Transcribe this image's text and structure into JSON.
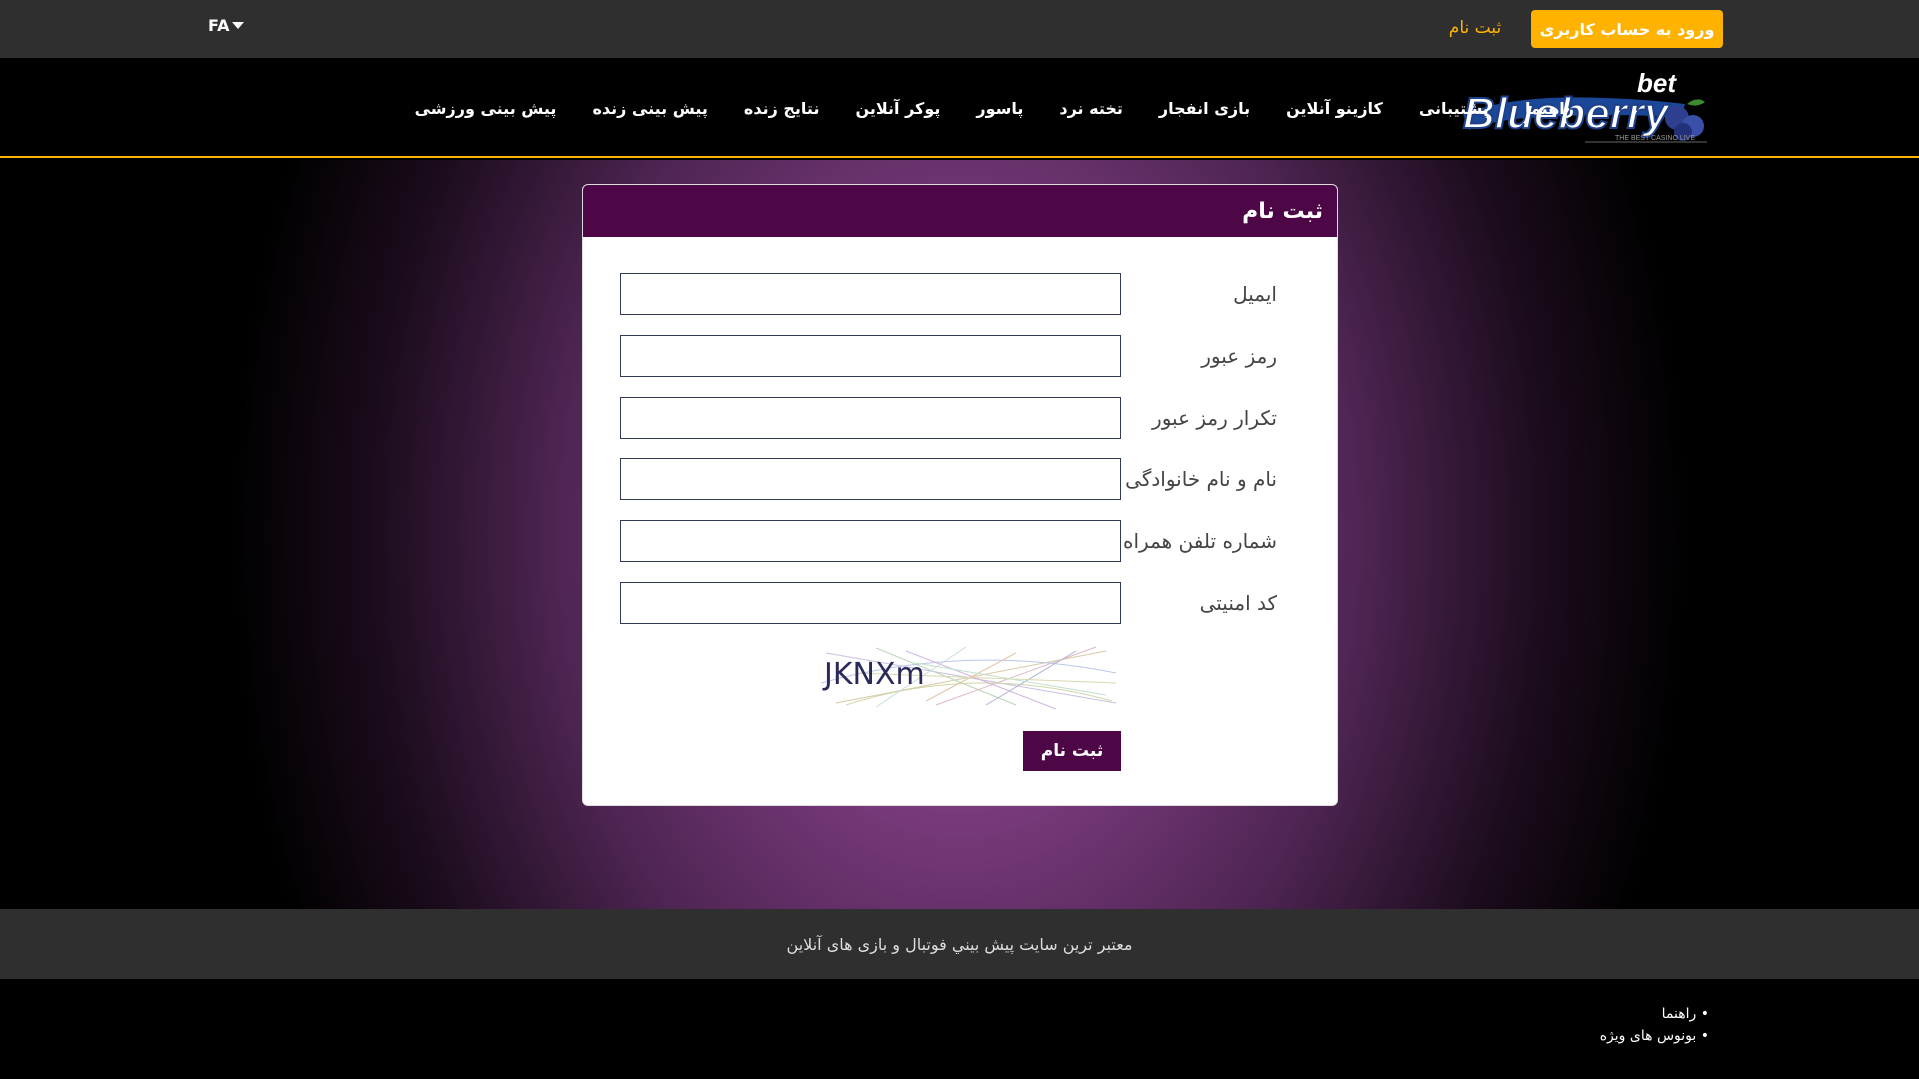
{
  "topbar": {
    "language": "FA",
    "login_label": "ورود به حساب کاربری",
    "register_label": "ثبت نام"
  },
  "logo": {
    "top": "bet",
    "name": "Blueberry",
    "tagline": "THE BEST CASINO LIVE"
  },
  "nav": {
    "items": [
      {
        "label": "پیش بینی ورزشی"
      },
      {
        "label": "پیش بینی زنده"
      },
      {
        "label": "نتایج زنده"
      },
      {
        "label": "پوکر آنلاین"
      },
      {
        "label": "پاسور"
      },
      {
        "label": "تخته نرد"
      },
      {
        "label": "بازی انفجار"
      },
      {
        "label": "کازینو آنلاین"
      },
      {
        "label": "پشتیبانی"
      },
      {
        "label": "راهنما"
      }
    ]
  },
  "form": {
    "title": "ثبت نام",
    "fields": [
      {
        "label": "ایمیل",
        "value": ""
      },
      {
        "label": "رمز عبور",
        "value": ""
      },
      {
        "label": "تکرار رمز عبور",
        "value": ""
      },
      {
        "label": "نام و نام خانوادگی",
        "value": ""
      },
      {
        "label": "شماره تلفن همراه",
        "value": ""
      },
      {
        "label": "کد امنیتی",
        "value": ""
      }
    ],
    "captcha_text": "JKNXm",
    "submit_label": "ثبت نام"
  },
  "footer": {
    "tagline": "معتبر ترین سایت پیش بيني فوتبال و بازی های آنلاین",
    "links": [
      {
        "label": "• راهنما"
      },
      {
        "label": "• بونوس های ویژه"
      }
    ]
  },
  "colors": {
    "accent": "#ffb300",
    "brand_purple": "#4e0746",
    "topbar_bg": "#2f2f2f"
  }
}
